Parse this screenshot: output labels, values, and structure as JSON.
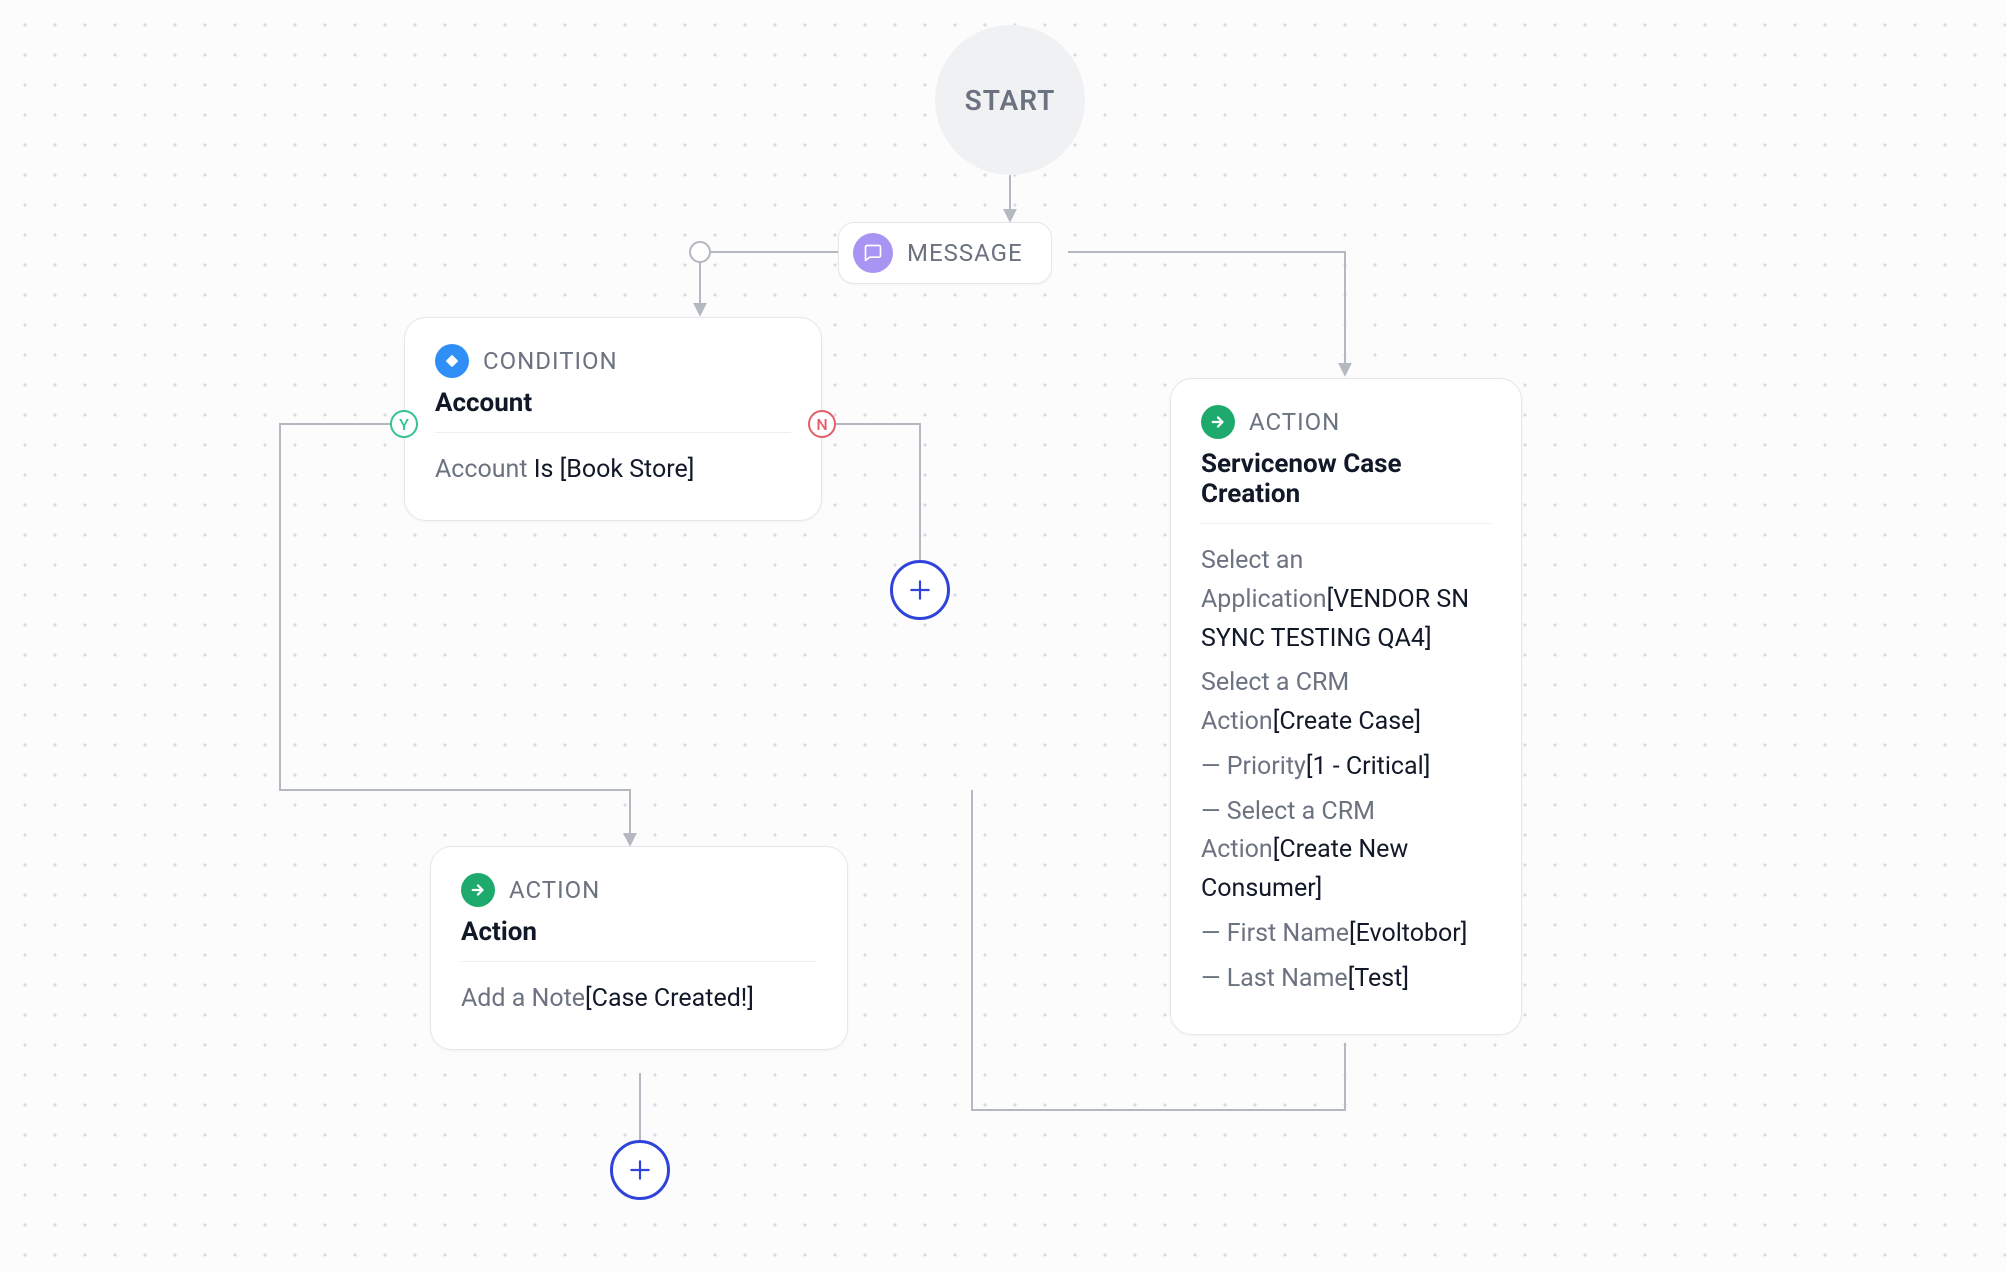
{
  "start": {
    "label": "START"
  },
  "message_node": {
    "type_label": "MESSAGE"
  },
  "condition_node": {
    "type_label": "CONDITION",
    "title": "Account",
    "field": "Account",
    "operator": "Is",
    "value": "[Book Store]",
    "edge_yes": "Y",
    "edge_no": "N"
  },
  "action_note_node": {
    "type_label": "ACTION",
    "title": "Action",
    "field": "Add a Note",
    "value": "[Case Created!]"
  },
  "action_sn_node": {
    "type_label": "ACTION",
    "title": "Servicenow Case Creation",
    "rows": [
      {
        "k": "Select an Application",
        "v": "[VENDOR SN SYNC TESTING QA4]"
      },
      {
        "k": "Select a CRM Action",
        "v": "[Create Case]"
      },
      {
        "k": "— Priority",
        "v": "[1 - Critical]"
      },
      {
        "k": "— Select a CRM Action",
        "v": "[Create New Consumer]"
      },
      {
        "k": "— First Name",
        "v": "[Evoltobor]"
      },
      {
        "k": "— Last Name",
        "v": "[Test]"
      }
    ]
  }
}
